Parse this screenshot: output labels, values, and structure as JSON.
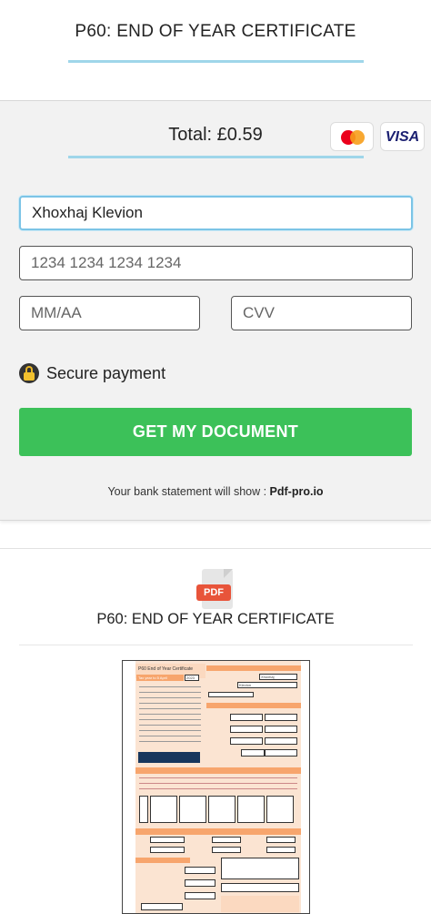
{
  "header": {
    "title": "P60: END OF YEAR CERTIFICATE"
  },
  "payment": {
    "total": "Total: £0.59",
    "card_logos": [
      {
        "name": "mastercard-logo",
        "text": ""
      },
      {
        "name": "visa-logo",
        "text": "VISA"
      }
    ],
    "name_field": {
      "value": "Xhoxhaj Klevion",
      "placeholder": ""
    },
    "card_field": {
      "value": "",
      "placeholder": "1234 1234 1234 1234"
    },
    "expiry_field": {
      "value": "",
      "placeholder": "MM/AA"
    },
    "cvv_field": {
      "value": "",
      "placeholder": "CVV"
    },
    "secure_label": "Secure payment",
    "cta_label": "GET MY DOCUMENT",
    "bank_statement_prefix": "Your bank statement will show : ",
    "bank_statement_name": "Pdf-pro.io"
  },
  "document": {
    "icon_label": "PDF",
    "title": "P60: END OF YEAR CERTIFICATE",
    "preview": {
      "form_title": "P60 End of Year Certificate",
      "tax_year_label": "Tax year to 5 April",
      "tax_year_value": "2023",
      "employee_surname": "Xhoxhaj",
      "employee_forename": "Klevion"
    }
  },
  "colors": {
    "accent_line": "#9fd6ea",
    "cta_background": "#3cc159",
    "pdf_badge": "#e8543a",
    "form_orange": "#f7a56d",
    "form_light": "#fbe4d2",
    "form_dark": "#17365d"
  }
}
